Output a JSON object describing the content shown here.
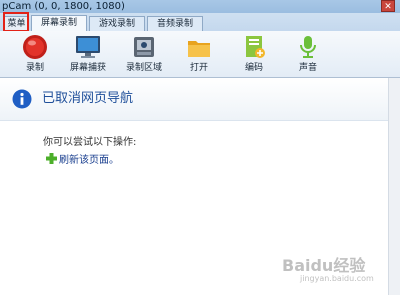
{
  "window": {
    "title": "pCam (0, 0, 1800, 1080)",
    "close_glyph": "✕"
  },
  "tabs": [
    {
      "label": "菜单",
      "active": false
    },
    {
      "label": "屏幕录制",
      "active": true
    },
    {
      "label": "游戏录制",
      "active": false
    },
    {
      "label": "音频录制",
      "active": false
    }
  ],
  "ribbon": [
    {
      "label": "录制",
      "icon": "record-icon"
    },
    {
      "label": "屏幕捕获",
      "icon": "monitor-icon"
    },
    {
      "label": "录制区域",
      "icon": "record-area-icon"
    },
    {
      "label": "打开",
      "icon": "folder-icon"
    },
    {
      "label": "编码",
      "icon": "encode-icon"
    },
    {
      "label": "声音",
      "icon": "microphone-icon"
    }
  ],
  "page": {
    "title": "已取消网页导航",
    "hint": "你可以尝试以下操作:",
    "refresh_link": "刷新该页面。"
  },
  "watermark": {
    "text": "Baidu经验",
    "sub": "jingyan.baidu.com"
  },
  "colors": {
    "highlight": "#e22218",
    "title_blue": "#1f4f9a",
    "link_blue": "#1a3f8f"
  }
}
